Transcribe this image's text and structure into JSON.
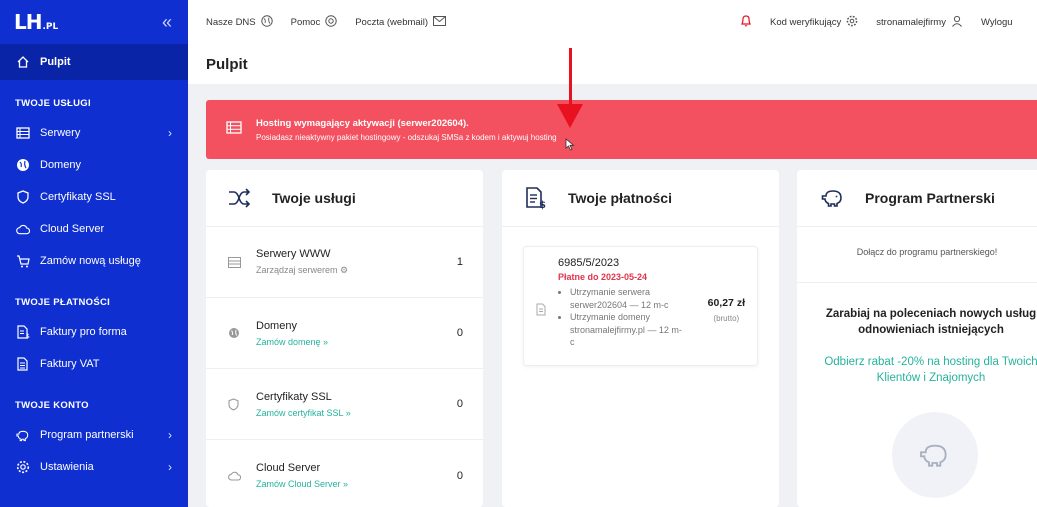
{
  "sidebar": {
    "logo": "LH",
    "logo_suffix": ".PL",
    "active": "Pulpit",
    "sections": [
      {
        "title": "TWOJE USŁUGI",
        "items": [
          "Serwery",
          "Domeny",
          "Certyfikaty SSL",
          "Cloud Server",
          "Zamów nową usługę"
        ]
      },
      {
        "title": "TWOJE PŁATNOŚCI",
        "items": [
          "Faktury pro forma",
          "Faktury VAT"
        ]
      },
      {
        "title": "TWOJE KONTO",
        "items": [
          "Program partnerski",
          "Ustawienia"
        ]
      }
    ]
  },
  "topbar": {
    "dns": "Nasze DNS",
    "help": "Pomoc",
    "mail": "Poczta (webmail)",
    "code": "Kod weryfikujący",
    "user": "stronamalejfirmy",
    "logout": "Wylogu"
  },
  "page": {
    "title": "Pulpit"
  },
  "alert": {
    "title": "Hosting wymagający aktywacji (serwer202604).",
    "text": "Posiadasz nieaktywny pakiet hostingowy - odszukaj SMSa z kodem i aktywuj hosting"
  },
  "services": {
    "title": "Twoje usługi",
    "rows": [
      {
        "name": "Serwery WWW",
        "sub": "Zarządzaj serwerem",
        "count": "1"
      },
      {
        "name": "Domeny",
        "sub": "Zamów domenę",
        "count": "0"
      },
      {
        "name": "Certyfikaty SSL",
        "sub": "Zamów certyfikat SSL",
        "count": "0"
      },
      {
        "name": "Cloud Server",
        "sub": "Zamów Cloud Server",
        "count": "0"
      }
    ]
  },
  "payments": {
    "title": "Twoje płatności",
    "invoice": {
      "number": "6985/5/2023",
      "due": "Płatne do 2023-05-24",
      "items": [
        "Utrzymanie serwera serwer202604 — 12 m-c",
        "Utrzymanie domeny stronamalejfirmy.pl — 12 m-c"
      ],
      "amount": "60,27 zł",
      "brutto": "(brutto)"
    }
  },
  "partner": {
    "title": "Program Partnerski",
    "join": "Dołącz do programu partnerskiego!",
    "earn_line1": "Zarabiaj na poleceniach nowych usług",
    "earn_line2": "odnowieniach istniejących",
    "rabat_line1": "Odbierz rabat -20% na hosting dla Twoich",
    "rabat_line2": "Klientów i Znajomych"
  },
  "colors": {
    "sidebar": "#0f2fd1",
    "alert": "#f3515f",
    "accent_green": "#25b39d",
    "due_red": "#e0344b"
  }
}
